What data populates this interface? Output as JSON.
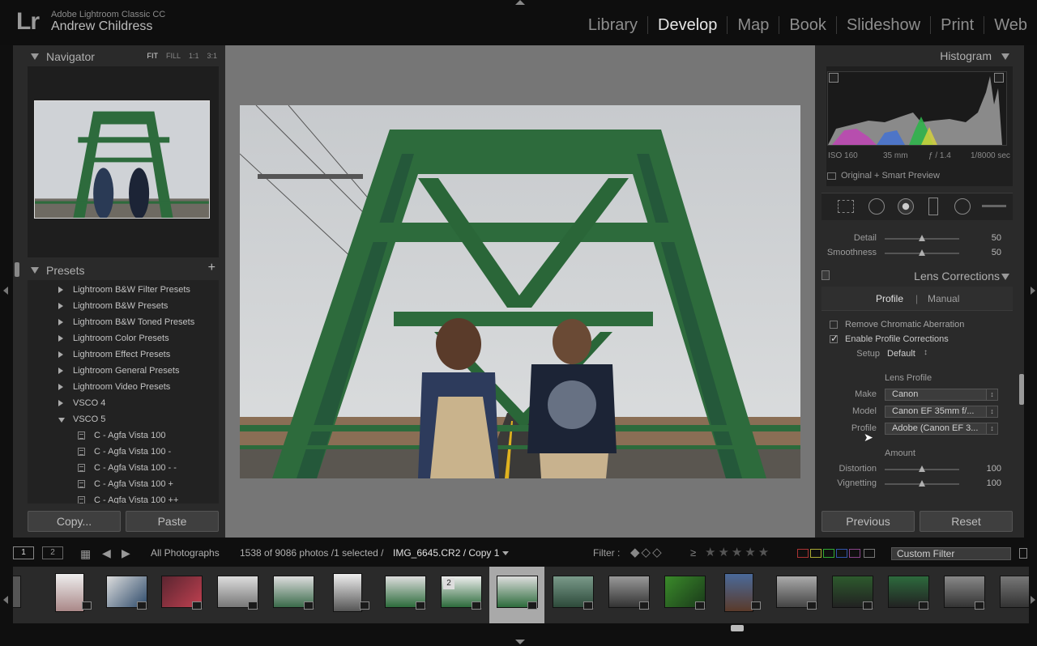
{
  "app": {
    "logo": "Lr",
    "name": "Adobe Lightroom Classic CC",
    "user": "Andrew Childress"
  },
  "modules": [
    {
      "label": "Library",
      "active": false
    },
    {
      "label": "Develop",
      "active": true
    },
    {
      "label": "Map",
      "active": false
    },
    {
      "label": "Book",
      "active": false
    },
    {
      "label": "Slideshow",
      "active": false
    },
    {
      "label": "Print",
      "active": false
    },
    {
      "label": "Web",
      "active": false
    }
  ],
  "navigator": {
    "title": "Navigator",
    "zoom": [
      "FIT",
      "FILL",
      "1:1",
      "3:1"
    ],
    "zoom_active": "FIT"
  },
  "presets": {
    "title": "Presets",
    "add": "+",
    "items": [
      {
        "label": "Lightroom B&W Filter Presets",
        "type": "folder",
        "open": false
      },
      {
        "label": "Lightroom B&W Presets",
        "type": "folder",
        "open": false
      },
      {
        "label": "Lightroom B&W Toned Presets",
        "type": "folder",
        "open": false
      },
      {
        "label": "Lightroom Color Presets",
        "type": "folder",
        "open": false
      },
      {
        "label": "Lightroom Effect Presets",
        "type": "folder",
        "open": false
      },
      {
        "label": "Lightroom General Presets",
        "type": "folder",
        "open": false
      },
      {
        "label": "Lightroom Video Presets",
        "type": "folder",
        "open": false
      },
      {
        "label": "VSCO 4",
        "type": "folder",
        "open": false
      },
      {
        "label": "VSCO 5",
        "type": "folder",
        "open": true
      },
      {
        "label": "C - Agfa Vista 100",
        "type": "preset"
      },
      {
        "label": "C - Agfa Vista 100 -",
        "type": "preset"
      },
      {
        "label": "C - Agfa Vista 100 - -",
        "type": "preset"
      },
      {
        "label": "C - Agfa Vista 100 +",
        "type": "preset"
      },
      {
        "label": "C - Agfa Vista 100 ++",
        "type": "preset"
      }
    ]
  },
  "left_buttons": {
    "copy": "Copy...",
    "paste": "Paste"
  },
  "histogram": {
    "title": "Histogram",
    "iso": "ISO 160",
    "focal": "35 mm",
    "aperture": "ƒ / 1.4",
    "shutter": "1/8000 sec",
    "preview": "Original + Smart Preview"
  },
  "detail": {
    "detail_label": "Detail",
    "detail_value": "50",
    "detail_pos": 0.5,
    "smooth_label": "Smoothness",
    "smooth_value": "50",
    "smooth_pos": 0.5
  },
  "lens": {
    "title": "Lens Corrections",
    "tab_profile": "Profile",
    "tab_sep": "|",
    "tab_manual": "Manual",
    "remove_ca": "Remove Chromatic Aberration",
    "remove_ca_checked": false,
    "enable_profile": "Enable Profile Corrections",
    "enable_profile_checked": true,
    "setup_label": "Setup",
    "setup_value": "Default",
    "lens_profile": "Lens Profile",
    "make_label": "Make",
    "make_value": "Canon",
    "model_label": "Model",
    "model_value": "Canon EF 35mm f/...",
    "profile_label": "Profile",
    "profile_value": "Adobe (Canon EF 3...",
    "amount": "Amount",
    "distortion_label": "Distortion",
    "distortion_value": "100",
    "distortion_pos": 0.5,
    "vignetting_label": "Vignetting",
    "vignetting_value": "100",
    "vignetting_pos": 0.5
  },
  "right_buttons": {
    "previous": "Previous",
    "reset": "Reset"
  },
  "filmbar": {
    "view1": "1",
    "view2": "2",
    "source": "All Photographs",
    "count": "1538 of 9086 photos /1 selected /",
    "filename": "IMG_6645.CR2 / Copy 1",
    "filter_label": "Filter :",
    "filter_op": "≥",
    "custom_filter": "Custom Filter"
  },
  "filmstrip": {
    "copy_badge": "2"
  },
  "colors": {
    "accent": "#e6e6e6",
    "panel": "#2a2a2a",
    "bridge": "#2d6b3c"
  }
}
